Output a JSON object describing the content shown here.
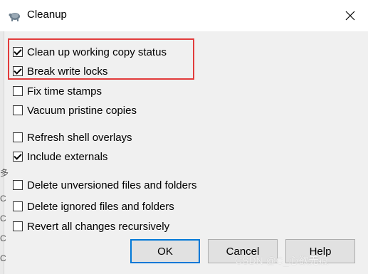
{
  "window": {
    "title": "Cleanup",
    "icon": "tortoise-icon",
    "close_icon": "close-icon"
  },
  "left_edge_glyphs": [
    "多",
    "C",
    "C",
    "C",
    "C"
  ],
  "options": [
    {
      "label": "Clean up working copy status",
      "checked": true
    },
    {
      "label": "Break write locks",
      "checked": true
    },
    {
      "label": "Fix time stamps",
      "checked": false
    },
    {
      "label": "Vacuum pristine copies",
      "checked": false
    },
    {
      "label": "Refresh shell overlays",
      "checked": false
    },
    {
      "label": "Include externals",
      "checked": true
    },
    {
      "label": "Delete unversioned files and folders",
      "checked": false
    },
    {
      "label": "Delete ignored files and folders",
      "checked": false
    },
    {
      "label": "Revert all changes recursively",
      "checked": false
    }
  ],
  "highlight_color": "#e23b3b",
  "buttons": {
    "ok": "OK",
    "cancel": "Cancel",
    "help": "Help"
  },
  "watermark": "CSDN @C_心欲无痕"
}
